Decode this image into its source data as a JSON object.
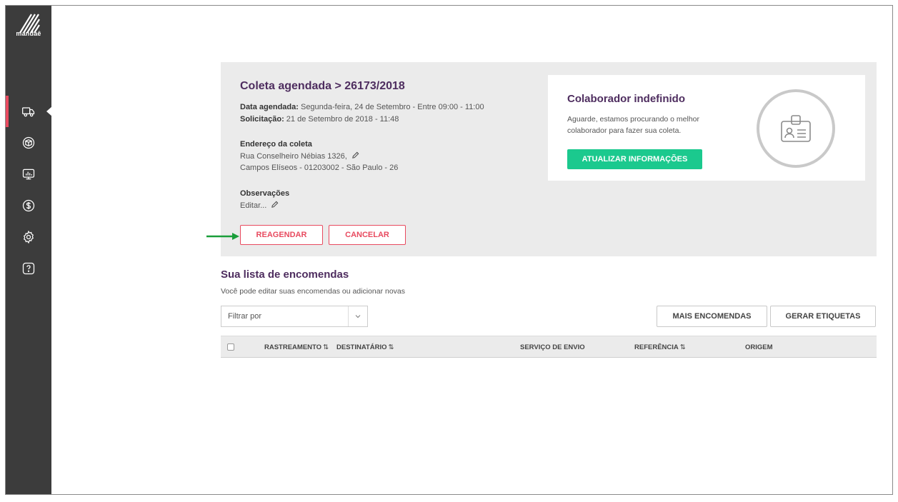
{
  "sidebar": {
    "logo_text": "mandaê",
    "items": [
      {
        "icon": "truck-icon",
        "active": true
      },
      {
        "icon": "box-icon",
        "active": false
      },
      {
        "icon": "dashboard-icon",
        "active": false
      },
      {
        "icon": "dollar-icon",
        "active": false
      },
      {
        "icon": "gear-icon",
        "active": false
      },
      {
        "icon": "help-icon",
        "active": false
      }
    ]
  },
  "coleta": {
    "title": "Coleta agendada > 26173/2018",
    "data_label": "Data agendada:",
    "data_value": " Segunda-feira, 24 de Setembro - Entre 09:00 - 11:00",
    "solicitacao_label": "Solicitação:",
    "solicitacao_value": " 21 de Setembro de 2018 - 11:48",
    "endereco_title": "Endereço da coleta",
    "endereco_line1": "Rua Conselheiro Nébias 1326,",
    "endereco_line2": "Campos Elíseos - 01203002 - São Paulo - 26",
    "obs_title": "Observações",
    "obs_edit": "Editar...",
    "reagendar_label": "REAGENDAR",
    "cancelar_label": "CANCELAR"
  },
  "colaborador": {
    "title": "Colaborador indefinido",
    "text": "Aguarde, estamos procurando o melhor colaborador para fazer sua coleta.",
    "button_label": "ATUALIZAR INFORMAÇÕES"
  },
  "list": {
    "title": "Sua lista de encomendas",
    "subtitle": "Você pode editar suas encomendas ou adicionar novas",
    "filter_placeholder": "Filtrar por",
    "mais_label": "MAIS ENCOMENDAS",
    "gerar_label": "GERAR ETIQUETAS",
    "columns": [
      "RASTREAMENTO",
      "DESTINATÁRIO",
      "SERVIÇO DE ENVIO",
      "REFERÊNCIA",
      "ORIGEM"
    ],
    "sort_glyph": "⇅"
  },
  "colors": {
    "accent_purple": "#4e2d5f",
    "accent_red": "#e84a5f",
    "accent_green": "#1bc98e",
    "sidebar_bg": "#3c3c3c"
  }
}
